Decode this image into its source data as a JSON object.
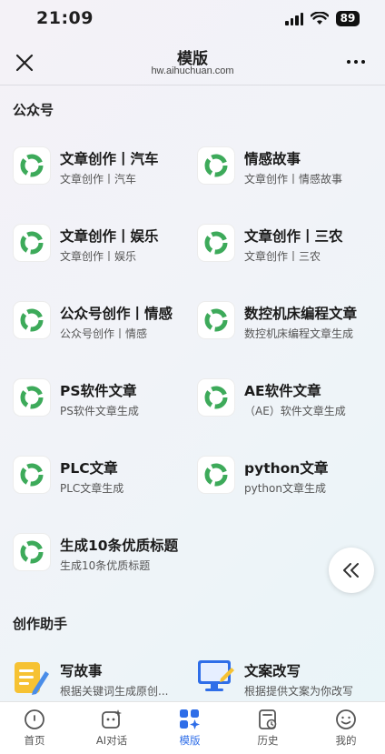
{
  "status_bar": {
    "time": "21:09",
    "battery": "89"
  },
  "header": {
    "title": "模版",
    "subtitle": "hw.aihuchuan.com"
  },
  "sections": [
    {
      "title": "公众号",
      "items": [
        {
          "title": "文章创作丨汽车",
          "desc": "文章创作丨汽车"
        },
        {
          "title": "情感故事",
          "desc": "文章创作丨情感故事"
        },
        {
          "title": "文章创作丨娱乐",
          "desc": "文章创作丨娱乐"
        },
        {
          "title": "文章创作丨三农",
          "desc": "文章创作丨三农"
        },
        {
          "title": "公众号创作丨情感",
          "desc": "公众号创作丨情感"
        },
        {
          "title": "数控机床编程文章",
          "desc": "数控机床编程文章生成"
        },
        {
          "title": "PS软件文章",
          "desc": "PS软件文章生成"
        },
        {
          "title": "AE软件文章",
          "desc": "（AE）软件文章生成"
        },
        {
          "title": "PLC文章",
          "desc": "PLC文章生成"
        },
        {
          "title": "python文章",
          "desc": "python文章生成"
        },
        {
          "title": "生成10条优质标题",
          "desc": "生成10条优质标题"
        }
      ]
    },
    {
      "title": "创作助手",
      "items": [
        {
          "title": "写故事",
          "desc": "根据关键词生成原创..."
        },
        {
          "title": "文案改写",
          "desc": "根据提供文案为你改写"
        }
      ]
    }
  ],
  "tabs": [
    {
      "label": "首页",
      "icon": "home-icon"
    },
    {
      "label": "AI对话",
      "icon": "ai-chat-icon"
    },
    {
      "label": "模版",
      "icon": "template-icon",
      "active": true
    },
    {
      "label": "历史",
      "icon": "history-icon"
    },
    {
      "label": "我的",
      "icon": "profile-icon"
    }
  ],
  "colors": {
    "accent": "#2f6ee8",
    "brand_green": "#3daa5a",
    "pencil_yellow": "#f6c233"
  }
}
